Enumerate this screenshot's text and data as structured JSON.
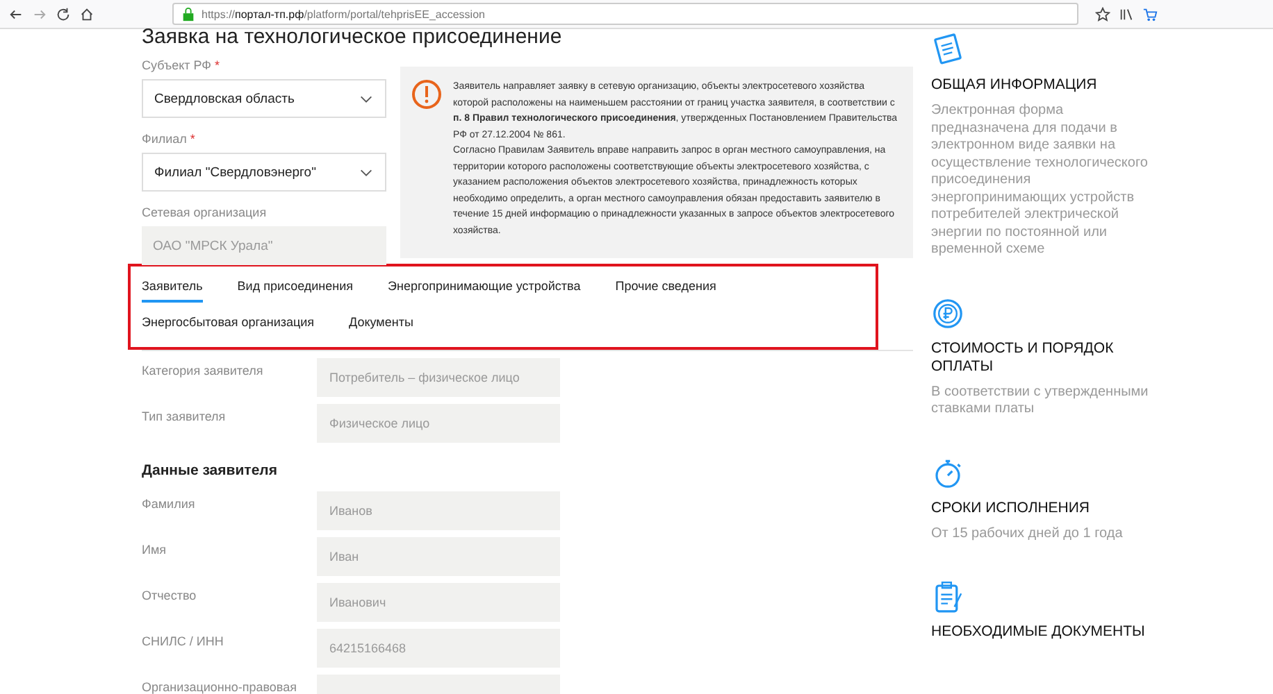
{
  "browser": {
    "url_scheme": "https://",
    "url_host": "портал-тп.рф",
    "url_path": "/platform/portal/tehprisEE_accession"
  },
  "page_title": "Заявка на технологическое присоединение",
  "top_fields": [
    {
      "label": "Субъект РФ",
      "required_mark": "*",
      "kind": "select",
      "value": "Свердловская область"
    },
    {
      "label": "Филиал",
      "required_mark": "*",
      "kind": "select",
      "value": "Филиал \"Свердловэнерго\""
    },
    {
      "label": "Сетевая организация",
      "kind": "readonly",
      "value": "ОАО \"МРСК Урала\""
    }
  ],
  "notice": {
    "paragraphs": [
      "Заявитель направляет заявку в сетевую организацию, объекты электросетевого хозяйства которой расположены на наименьшем расстоянии от границ участка заявителя, в соответствии с **п. 8 Правил технологического присоединения**, утвержденных Постановлением Правительства РФ от 27.12.2004 № 861.",
      "Согласно Правилам Заявитель вправе направить запрос в орган местного самоуправления, на территории которого расположены соответствующие объекты электросетевого хозяйства, с указанием расположения объектов электросетевого хозяйства, принадлежность которых необходимо определить, а орган местного самоуправления обязан предоставить заявителю в течение 15 дней информацию о принадлежности указанных в запросе объектов электросетевого хозяйства."
    ]
  },
  "tabs": [
    {
      "label": "Заявитель",
      "selected": true
    },
    {
      "label": "Вид присоединения",
      "selected": false
    },
    {
      "label": "Энергопринимающие устройства",
      "selected": false
    },
    {
      "label": "Прочие сведения",
      "selected": false
    },
    {
      "label": "Энергосбытовая организация",
      "selected": false
    },
    {
      "label": "Документы",
      "selected": false
    }
  ],
  "applicant_fields": [
    {
      "label": "Категория заявителя",
      "value": "Потребитель – физическое лицо"
    },
    {
      "label": "Тип заявителя",
      "value": "Физическое лицо"
    }
  ],
  "section_title": "Данные заявителя",
  "personal_fields": [
    {
      "label": "Фамилия",
      "value": "Иванов"
    },
    {
      "label": "Имя",
      "value": "Иван"
    },
    {
      "label": "Отчество",
      "value": "Иванович"
    },
    {
      "label": "СНИЛС / ИНН",
      "value": "64215166468"
    },
    {
      "label": "Организационно-правовая"
    }
  ],
  "sidebar": [
    {
      "kind": "document",
      "title": "ОБЩАЯ ИНФОРМАЦИЯ",
      "text": "Электронная форма предназначена для подачи в электронном виде заявки на осуществление технологического присоединения энергопринимающих устройств потребителей электрической энергии по постоянной или временной схеме"
    },
    {
      "kind": "coin",
      "title": "СТОИМОСТЬ И ПОРЯДОК ОПЛАТЫ",
      "text": "В соответствии с утвержденными ставками платы"
    },
    {
      "kind": "stopwatch",
      "title": "СРОКИ ИСПОЛНЕНИЯ",
      "text": "От 15 рабочих дней до 1 года"
    },
    {
      "kind": "clipboard",
      "title": "НЕОБХОДИМЫЕ ДОКУМЕНТЫ"
    }
  ]
}
